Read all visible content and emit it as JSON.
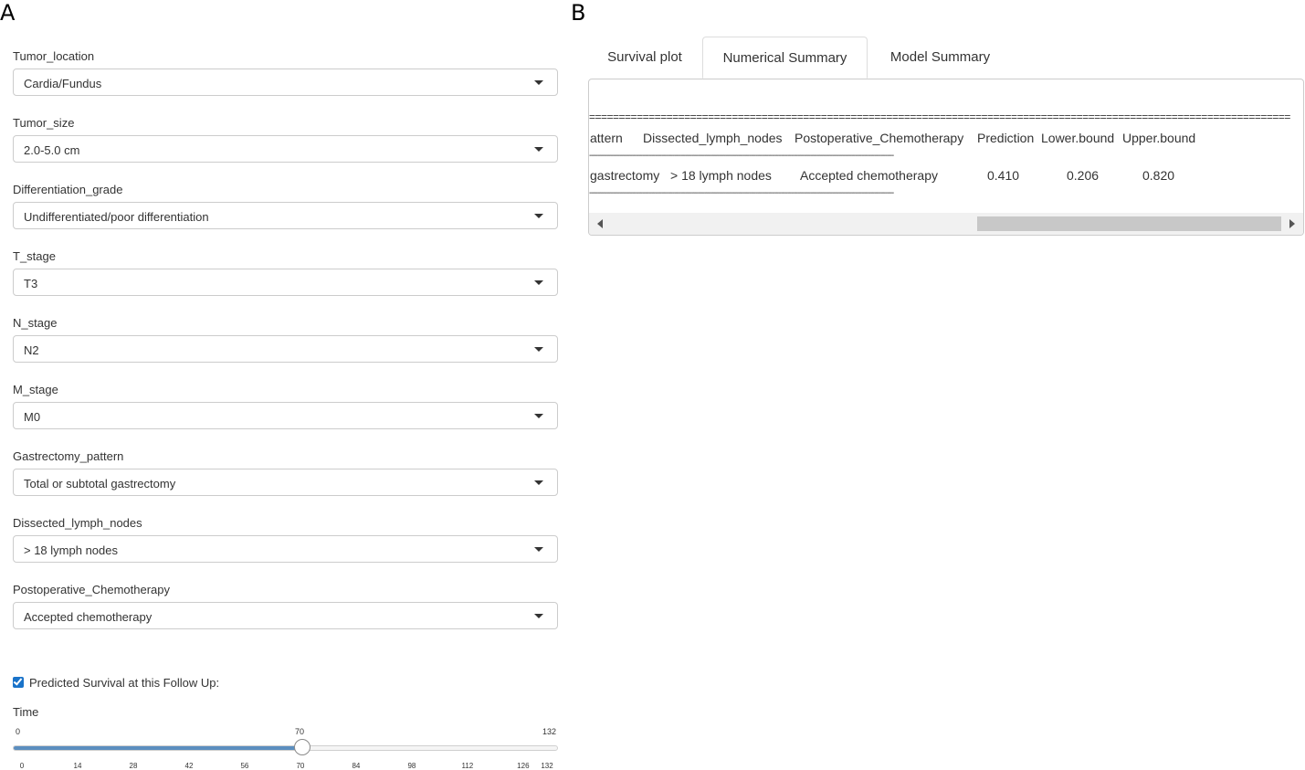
{
  "panel_letters": {
    "a": "A",
    "b": "B"
  },
  "form": {
    "fields": [
      {
        "label": "Tumor_location",
        "value": "Cardia/Fundus"
      },
      {
        "label": "Tumor_size",
        "value": "2.0-5.0 cm"
      },
      {
        "label": "Differentiation_grade",
        "value": "Undifferentiated/poor differentiation"
      },
      {
        "label": "T_stage",
        "value": "T3"
      },
      {
        "label": "N_stage",
        "value": "N2"
      },
      {
        "label": "M_stage",
        "value": "M0"
      },
      {
        "label": "Gastrectomy_pattern",
        "value": "Total or subtotal gastrectomy"
      },
      {
        "label": "Dissected_lymph_nodes",
        "value": "> 18 lymph nodes"
      },
      {
        "label": "Postoperative_Chemotherapy",
        "value": "Accepted chemotherapy"
      }
    ],
    "checkbox": {
      "label": "Predicted Survival at this Follow Up:",
      "checked": true,
      "color": "#1a73c9"
    },
    "slider": {
      "label": "Time",
      "min": 0,
      "max": 132,
      "value": 70,
      "min_label": "0",
      "max_label": "132",
      "value_label": "70",
      "ticks": [
        "0",
        "14",
        "28",
        "42",
        "56",
        "70",
        "84",
        "98",
        "112",
        "126",
        "132"
      ],
      "fill_color": "#5b8ebf"
    }
  },
  "tabs": {
    "items": [
      "Survival plot",
      "Numerical Summary",
      "Model Summary"
    ],
    "active": "Numerical Summary"
  },
  "output": {
    "rule_eq": "======================================================================================================================",
    "rule_dash": "-----------------------------------------------------------------------------------------------------------------------------------------------",
    "header": {
      "col1": "attern",
      "col2": "Dissected_lymph_nodes",
      "col3": "Postoperative_Chemotherapy",
      "col4": "Prediction",
      "col5": "Lower.bound",
      "col6": "Upper.bound"
    },
    "row": {
      "col1": "gastrectomy",
      "col2": "> 18 lymph nodes",
      "col3": "Accepted chemotherapy",
      "col4": "0.410",
      "col5": "0.206",
      "col6": "0.820"
    }
  }
}
